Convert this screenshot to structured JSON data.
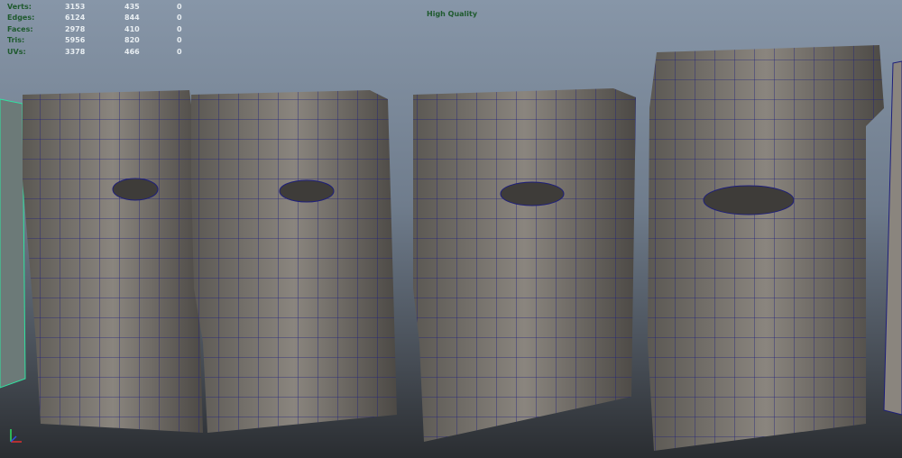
{
  "hud": {
    "rows": [
      {
        "label": "Verts:",
        "values": [
          "3153",
          "435",
          "0"
        ]
      },
      {
        "label": "Edges:",
        "values": [
          "6124",
          "844",
          "0"
        ]
      },
      {
        "label": "Faces:",
        "values": [
          "2978",
          "410",
          "0"
        ]
      },
      {
        "label": "Tris:",
        "values": [
          "5956",
          "820",
          "0"
        ]
      },
      {
        "label": "UVs:",
        "values": [
          "3378",
          "466",
          "0"
        ]
      }
    ],
    "quality": "High Quality"
  },
  "colors": {
    "mesh": "#6e6a64",
    "wire": "#1e1f7a",
    "hud_label": "#1f5a2e",
    "selected_wire": "#2fe3a0"
  }
}
